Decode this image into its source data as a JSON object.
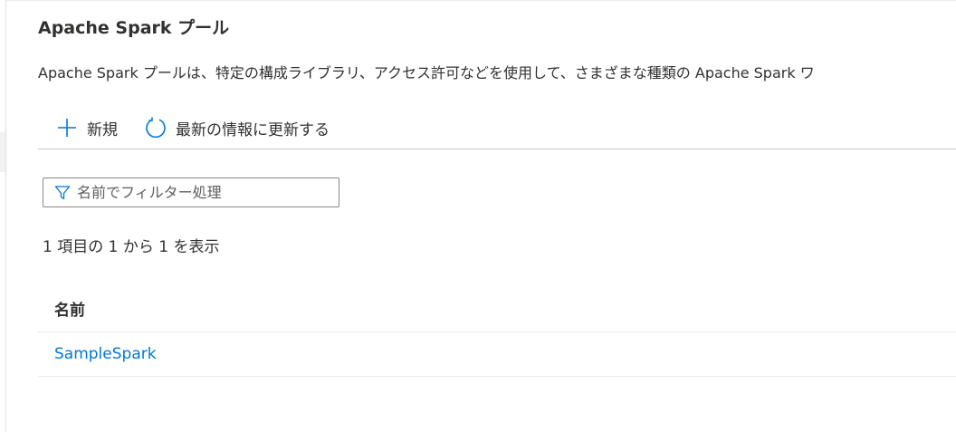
{
  "header": {
    "title": "Apache Spark プール",
    "description": "Apache Spark プールは、特定の構成ライブラリ、アクセス許可などを使用して、さまざまな種類の Apache Spark ワ"
  },
  "toolbar": {
    "new_label": "新規",
    "refresh_label": "最新の情報に更新する"
  },
  "filter": {
    "placeholder": "名前でフィルター処理",
    "value": ""
  },
  "summary": {
    "count_text": "1 項目の 1 から 1 を表示"
  },
  "table": {
    "columns": [
      "名前"
    ],
    "rows": [
      {
        "name": "SampleSpark"
      }
    ]
  },
  "colors": {
    "accent": "#0078d4",
    "text": "#323130",
    "border": "#c8c6c4"
  },
  "icons": {
    "new": "plus-icon",
    "refresh": "refresh-icon",
    "filter": "filter-icon"
  }
}
